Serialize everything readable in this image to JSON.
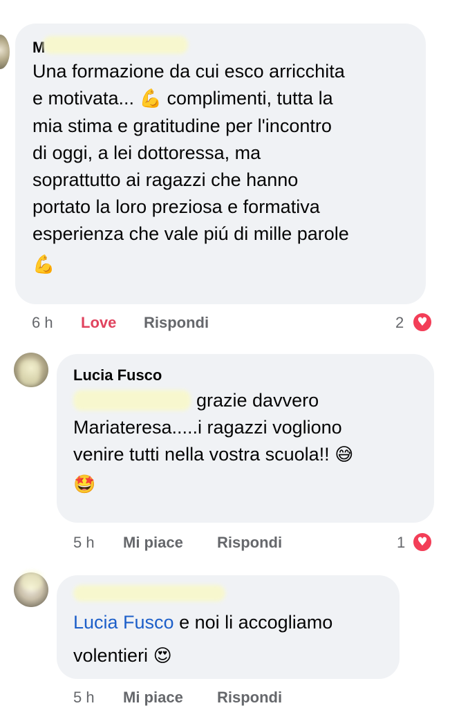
{
  "comments": [
    {
      "author": "M",
      "author_redacted": true,
      "text_lines": [
        "Una formazione da cui esco arricchita",
        "e motivata...",
        "complimenti, tutta la",
        "mia stima e gratitudine per l'incontro",
        "di oggi, a lei dottoressa, ma",
        "soprattutto ai ragazzi che hanno",
        "portato la loro preziosa e formativa",
        "esperienza che vale piú di mille parole"
      ],
      "inline_emoji": "💪",
      "trailing_emoji": "💪",
      "time": "6 h",
      "reaction_action": "Love",
      "reply_action": "Rispondi",
      "reaction_count": "2",
      "reaction_icon": "heart-reaction-icon"
    },
    {
      "author": "Lucia Fusco",
      "mention_redacted": true,
      "text_lines": [
        "grazie davvero",
        "Mariateresa.....i ragazzi vogliono",
        "venire tutti nella vostra scuola!!"
      ],
      "inline_emoji": "😅",
      "trailing_emoji": "🤩",
      "time": "5 h",
      "like_action": "Mi piace",
      "reply_action": "Rispondi",
      "reaction_count": "1",
      "reaction_icon": "heart-reaction-icon"
    },
    {
      "author_redacted": true,
      "mention": "Lucia Fusco",
      "text_lines": [
        "e noi li accogliamo",
        "volentieri"
      ],
      "inline_emoji": "😍",
      "time": "5 h",
      "like_action": "Mi piace",
      "reply_action": "Rispondi"
    }
  ],
  "colors": {
    "bubble": "#f0f2f5",
    "meta_text": "#65676b",
    "love": "#e0435e",
    "mention": "#1d5fc9",
    "heart": "#f33e58"
  }
}
